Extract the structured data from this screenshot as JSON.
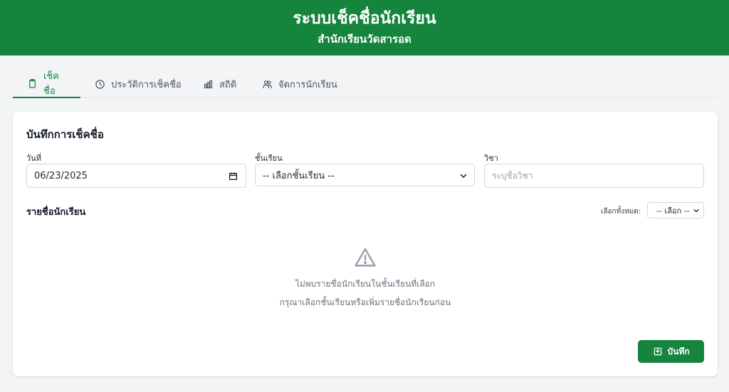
{
  "header": {
    "title": "ระบบเช็คชื่อนักเรียน",
    "subtitle": "สำนักเรียนวัดสารอด"
  },
  "tabs": [
    {
      "label": "เช็คชื่อ",
      "icon": "clipboard-icon",
      "active": true
    },
    {
      "label": "ประวัติการเช็คชื่อ",
      "icon": "clock-icon",
      "active": false
    },
    {
      "label": "สถิติ",
      "icon": "bar-chart-icon",
      "active": false
    },
    {
      "label": "จัดการนักเรียน",
      "icon": "users-icon",
      "active": false
    }
  ],
  "form": {
    "title": "บันทึกการเช็คชื่อ",
    "date": {
      "label": "วันที่",
      "value": "06/23/2025"
    },
    "class": {
      "label": "ชั้นเรียน",
      "value": "-- เลือกชั้นเรียน --"
    },
    "subject": {
      "label": "วิชา",
      "placeholder": "ระบุชื่อวิชา"
    }
  },
  "students": {
    "title": "รายชื่อนักเรียน",
    "select_all_label": "เลือกทั้งหมด:",
    "select_all_value": "-- เลือก --",
    "empty_line1": "ไม่พบรายชื่อนักเรียนในชั้นเรียนที่เลือก",
    "empty_line2": "กรุณาเลือกชั้นเรียนหรือเพิ่มรายชื่อนักเรียนก่อน"
  },
  "actions": {
    "save_label": "บันทึก"
  },
  "colors": {
    "brand": "#15843d",
    "background": "#f3f4f6"
  }
}
